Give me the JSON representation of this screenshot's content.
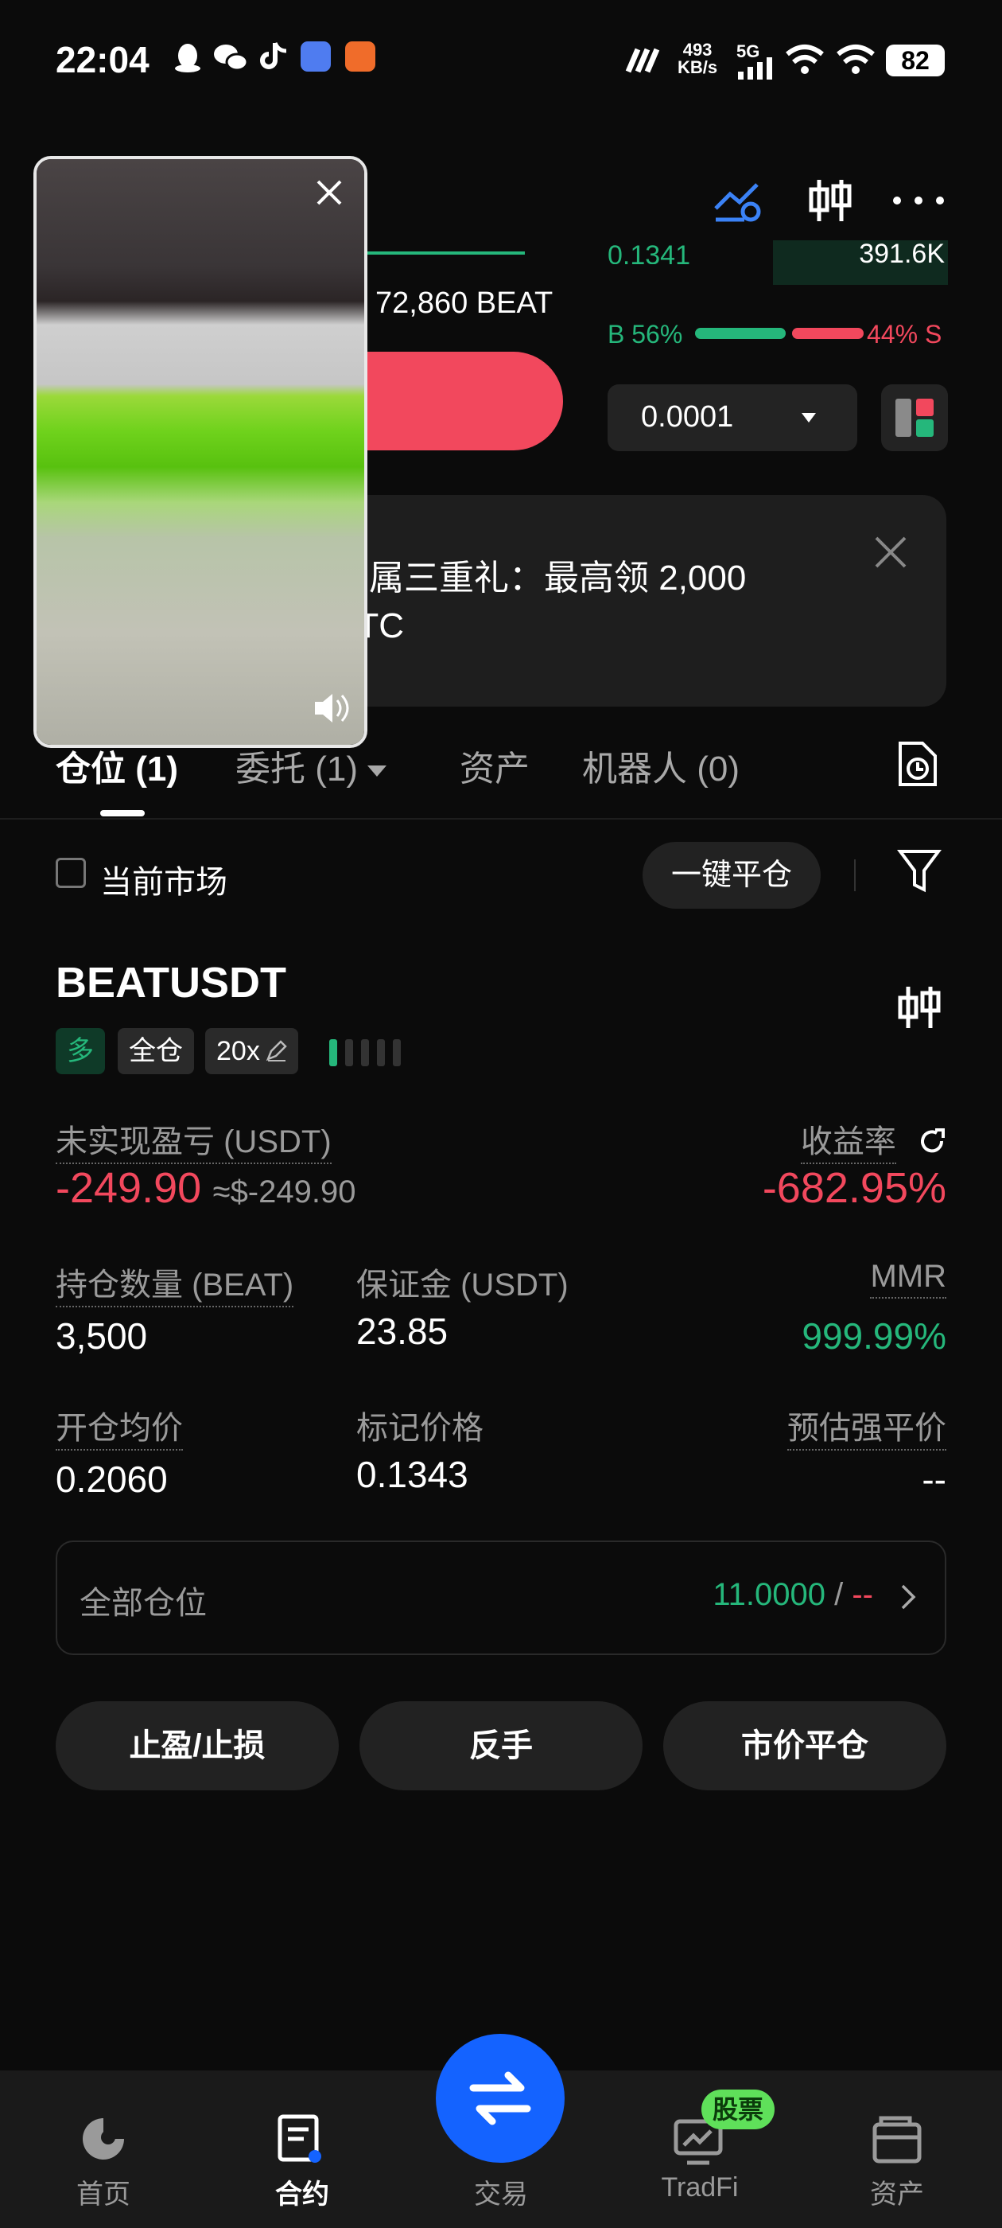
{
  "status_bar": {
    "time": "22:04",
    "net_speed_value": "493",
    "net_speed_unit": "KB/s",
    "net_type": "5G",
    "battery": "82"
  },
  "orderbook": {
    "price_fragment": "0.1341",
    "size_fragment": "391.6K",
    "size_label": "72,860 BEAT",
    "buy_ratio": "B 56%",
    "sell_ratio": "44% S",
    "buy_pct": 56,
    "precision": "0.0001"
  },
  "banner": {
    "line1": "专属三重礼：最高领 2,000",
    "line2": "BTC"
  },
  "tabs": [
    {
      "label": "仓位 (1)"
    },
    {
      "label": "委托 (1)"
    },
    {
      "label": "资产"
    },
    {
      "label": "机器人 (0)"
    }
  ],
  "filters": {
    "current_market": "当前市场",
    "close_all": "一键平仓"
  },
  "position": {
    "symbol": "BEATUSDT",
    "side": "多",
    "margin_mode": "全仓",
    "leverage": "20x",
    "unrealized_label": "未实现盈亏 (USDT)",
    "unrealized_value": "-249.90",
    "unrealized_approx": "≈$-249.90",
    "roe_label": "收益率",
    "roe_value": "-682.95%",
    "qty_label": "持仓数量 (BEAT)",
    "qty_value": "3,500",
    "margin_label": "保证金 (USDT)",
    "margin_value": "23.85",
    "mmr_label": "MMR",
    "mmr_value": "999.99%",
    "entry_label": "开仓均价",
    "entry_value": "0.2060",
    "mark_label": "标记价格",
    "mark_value": "0.1343",
    "liq_label": "预估强平价",
    "liq_value": "--",
    "all_positions_label": "全部仓位",
    "all_positions_value": "11.0000",
    "all_positions_sep": " / ",
    "all_positions_value2": "--"
  },
  "actions": {
    "tpsl": "止盈/止损",
    "reverse": "反手",
    "market_close": "市价平仓"
  },
  "nav": {
    "home": "首页",
    "futures": "合约",
    "trade": "交易",
    "tradfi": "TradFi",
    "tradfi_badge": "股票",
    "assets": "资产"
  },
  "colors": {
    "green": "#25b77b",
    "red": "#f2485d",
    "blue": "#1463ff"
  }
}
